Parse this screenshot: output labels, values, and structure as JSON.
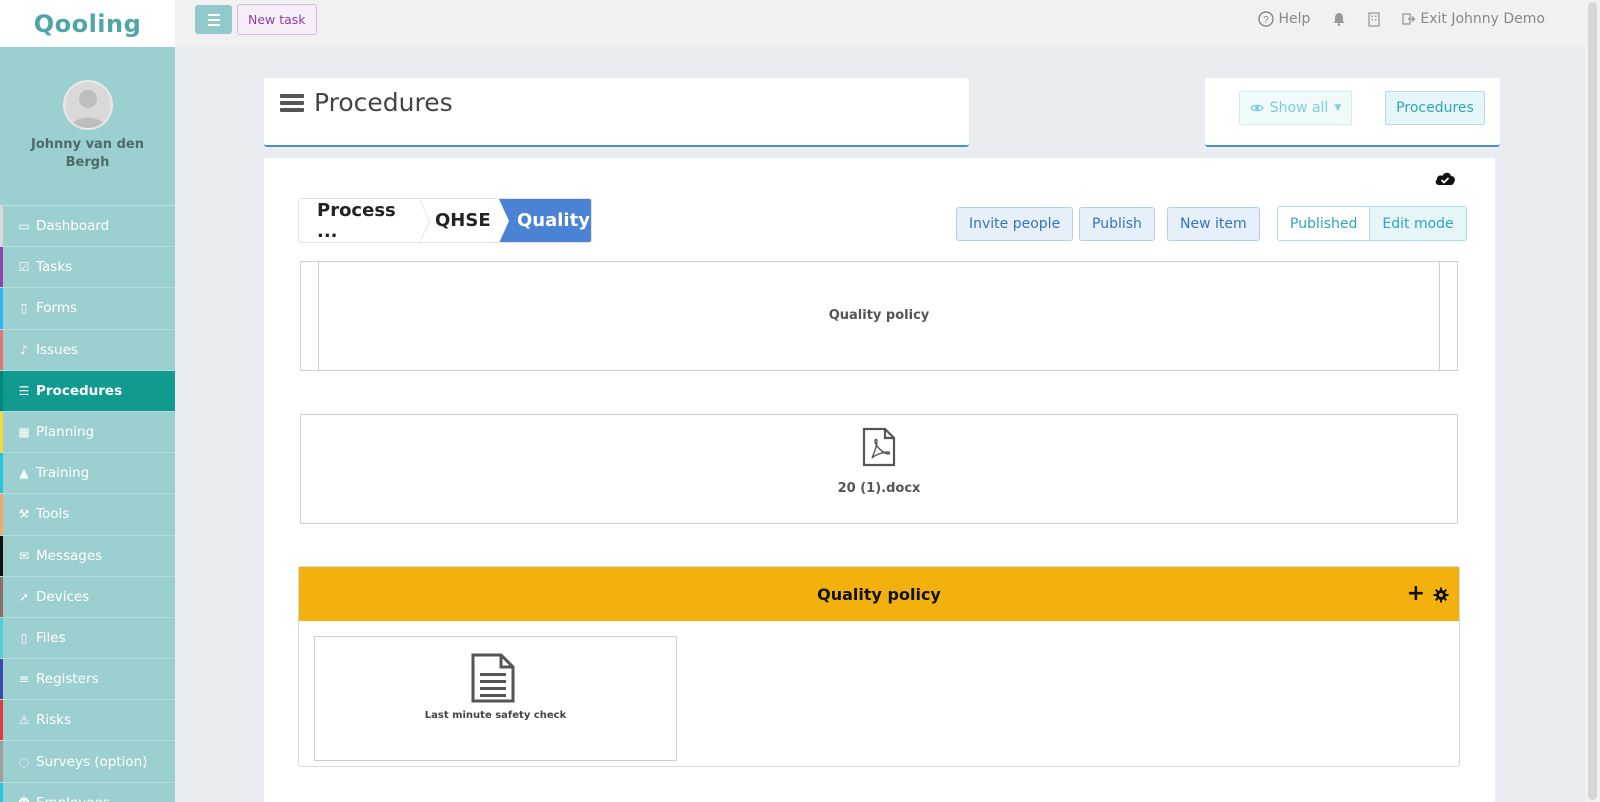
{
  "app": {
    "logo": "Qooling"
  },
  "user": {
    "name": "Johnny van den Bergh"
  },
  "sidebar": {
    "items": [
      {
        "label": "Dashboard",
        "icon": "monitor-icon",
        "stripe": "#d9d9d9"
      },
      {
        "label": "Tasks",
        "icon": "checkbox-icon",
        "stripe": "#8e44ad"
      },
      {
        "label": "Forms",
        "icon": "file-icon",
        "stripe": "#29b6f6"
      },
      {
        "label": "Issues",
        "icon": "bell-icon",
        "stripe": "#e57373"
      },
      {
        "label": "Procedures",
        "icon": "procedures-icon",
        "stripe": "#00897b",
        "active": true
      },
      {
        "label": "Planning",
        "icon": "calendar-icon",
        "stripe": "#fdd835"
      },
      {
        "label": "Training",
        "icon": "graduation-cap-icon",
        "stripe": "#26c6da"
      },
      {
        "label": "Tools",
        "icon": "wrench-icon",
        "stripe": "#f0a96b"
      },
      {
        "label": "Messages",
        "icon": "envelope-icon",
        "stripe": "#111111"
      },
      {
        "label": "Devices",
        "icon": "rocket-icon",
        "stripe": "#8d6e63"
      },
      {
        "label": "Files",
        "icon": "pdf-file-icon",
        "stripe": "#4dd0e1"
      },
      {
        "label": "Registers",
        "icon": "list-icon",
        "stripe": "#3949ab"
      },
      {
        "label": "Risks",
        "icon": "warning-icon",
        "stripe": "#e53935"
      },
      {
        "label": "Surveys (option)",
        "icon": "comment-icon",
        "stripe": "#9e9e9e"
      },
      {
        "label": "Employees",
        "icon": "users-icon",
        "stripe": "#26c6da"
      }
    ]
  },
  "topbar": {
    "new_task": "New task",
    "help": "Help",
    "exit": "Exit Johnny Demo"
  },
  "header": {
    "title": "Procedures",
    "show_all": "Show all",
    "procedures_btn": "Procedures"
  },
  "breadcrumb": {
    "items": [
      "Process ...",
      "QHSE",
      "Quality"
    ]
  },
  "actions": {
    "invite": "Invite people",
    "publish": "Publish",
    "new_item": "New item",
    "published": "Published",
    "edit_mode": "Edit mode"
  },
  "content": {
    "box1_label": "Quality policy",
    "file_name": "20 (1).docx",
    "section_title": "Quality policy",
    "tile_label": "Last minute safety check"
  }
}
